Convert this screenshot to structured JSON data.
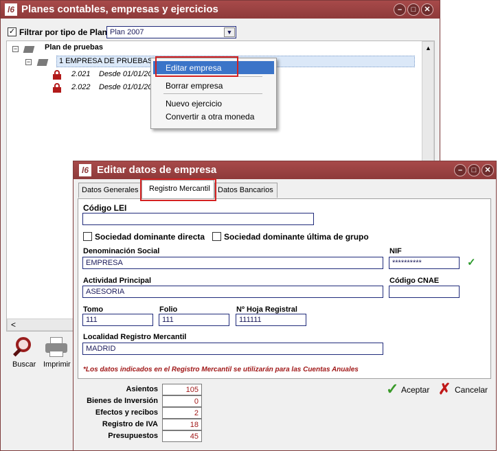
{
  "back_window": {
    "title": "Planes contables, empresas y ejercicios",
    "logo_text": "l6",
    "filter_label": "Filtrar por tipo de Plan",
    "filter_checked": true,
    "plan_select": "Plan 2007",
    "tree": {
      "root_label": "Plan de pruebas",
      "company_label": "1 EMPRESA DE PRUEBAS S.",
      "years": [
        {
          "code": "2.021",
          "desde": "Desde 01/01/20"
        },
        {
          "code": "2.022",
          "desde": "Desde 01/01/20"
        }
      ]
    },
    "toolbar": {
      "buscar": "Buscar",
      "imprimir": "Imprimir"
    },
    "scroll_left_glyph": "<"
  },
  "context_menu": {
    "items": [
      {
        "label": "Editar empresa",
        "selected": true
      },
      {
        "label": "Borrar empresa",
        "selected": false
      },
      {
        "label": "Nuevo ejercicio",
        "selected": false
      },
      {
        "label": "Convertir a otra moneda",
        "selected": false
      }
    ]
  },
  "front_window": {
    "title": "Editar datos de empresa",
    "logo_text": "l6",
    "tabs": [
      {
        "label": "Datos Generales",
        "active": false
      },
      {
        "label": "Registro Mercantil",
        "active": true
      },
      {
        "label": "Datos Bancarios",
        "active": false
      }
    ],
    "form": {
      "codigo_lei_label": "Código LEI",
      "codigo_lei_value": "",
      "soc_dominante_directa": "Sociedad dominante directa",
      "soc_dominante_ultima": "Sociedad dominante última de grupo",
      "denominacion_label": "Denominación Social",
      "denominacion_value": "EMPRESA",
      "nif_label": "NIF",
      "nif_value": "**********",
      "actividad_label": "Actividad Principal",
      "actividad_value": "ASESORIA",
      "cnae_label": "Código CNAE",
      "cnae_value": "",
      "tomo_label": "Tomo",
      "tomo_value": "111",
      "folio_label": "Folio",
      "folio_value": "111",
      "hoja_label": "Nº Hoja Registral",
      "hoja_value": "111111",
      "localidad_label": "Localidad Registro Mercantil",
      "localidad_value": "MADRID",
      "note": "*Los datos indicados en el Registro Mercantil se utilizarán para las Cuentas Anuales"
    },
    "stats": [
      {
        "label": "Asientos",
        "value": "105"
      },
      {
        "label": "Bienes de Inversión",
        "value": "0"
      },
      {
        "label": "Efectos y recibos",
        "value": "2"
      },
      {
        "label": "Registro de IVA",
        "value": "18"
      },
      {
        "label": "Presupuestos",
        "value": "45"
      }
    ],
    "aceptar": "Aceptar",
    "cancelar": "Cancelar"
  },
  "colors": {
    "titlebar": "#8e3a3a",
    "accent_red": "#d42020",
    "menu_selection": "#3b74c8",
    "field_border": "#1f2a7a"
  }
}
